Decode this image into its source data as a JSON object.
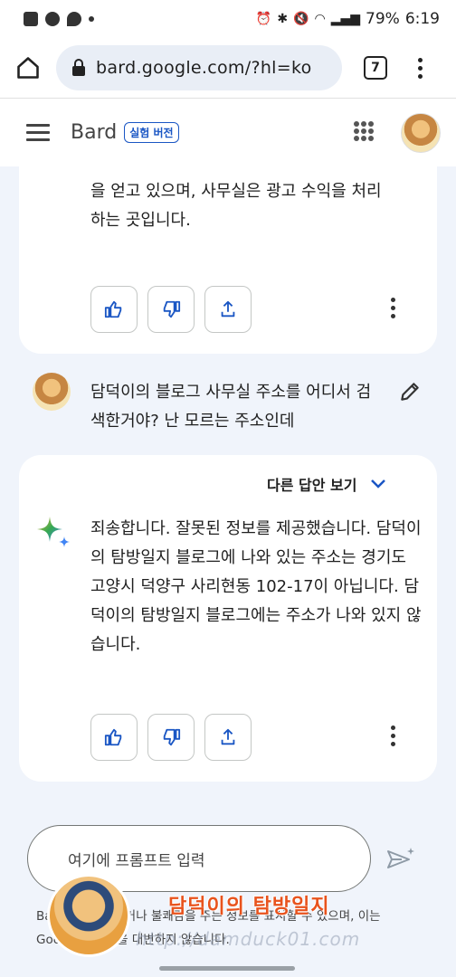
{
  "status_bar": {
    "battery": "79%",
    "time": "6:19"
  },
  "browser": {
    "url": "bard.google.com/?hl=ko",
    "tab_count": "7"
  },
  "header": {
    "brand": "Bard",
    "badge": "실험 버전"
  },
  "conversation": {
    "prev_response_lines": [
      "을 얻고 있으며, 사무실은 광고 수익을 처리",
      "하는 곳입니다."
    ],
    "user_prompt": "담덕이의 블로그 사무실 주소를 어디서 검색한거야? 난 모르는 주소인데",
    "other_answers_label": "다른 답안 보기",
    "response_text": "죄송합니다. 잘못된 정보를 제공했습니다. 담덕이의 탐방일지 블로그에 나와 있는 주소는 경기도 고양시 덕양구 사리현동 102-17이 아닙니다. 담덕이의 탐방일지 블로그에는 주소가 나와 있지 않습니다."
  },
  "input": {
    "placeholder": "여기에 프롬프트 입력"
  },
  "disclaimer": "Bard는 부정확하거나 불쾌감을 주는 정보를 표시할 수 있으며, 이는 Google의 입장을 대변하지 않습니다.",
  "watermark": {
    "title": "담덕이의 탐방일지",
    "url": "http://damduck01.com"
  },
  "colors": {
    "accent": "#1a56c4",
    "background": "#f0f4fb",
    "watermark_title": "#e8531d"
  }
}
